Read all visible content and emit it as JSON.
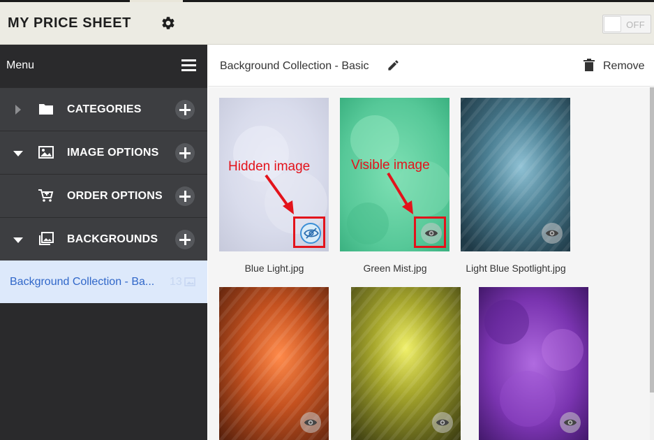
{
  "header": {
    "title": "MY PRICE SHEET",
    "toggle_label": "OFF"
  },
  "sidebar": {
    "menu_title": "Menu",
    "items": [
      {
        "label": "CATEGORIES",
        "icon": "folder-icon",
        "expanded": false
      },
      {
        "label": "IMAGE OPTIONS",
        "icon": "image-icon",
        "expanded": true
      },
      {
        "label": "ORDER OPTIONS",
        "icon": "cart-icon",
        "expanded": false
      },
      {
        "label": "BACKGROUNDS",
        "icon": "images-stack-icon",
        "expanded": true
      }
    ],
    "selected_collection": {
      "label": "Background Collection - Ba...",
      "count": "13"
    }
  },
  "main": {
    "title": "Background Collection - Basic",
    "remove_label": "Remove",
    "images": [
      {
        "name": "Blue Light.jpg",
        "visible": false
      },
      {
        "name": "Green Mist.jpg",
        "visible": true
      },
      {
        "name": "Light Blue Spotlight.jpg",
        "visible": true
      },
      {
        "name": "",
        "visible": true
      },
      {
        "name": "",
        "visible": true
      },
      {
        "name": "",
        "visible": true
      }
    ]
  },
  "annotations": {
    "hidden": "Hidden image",
    "visible": "Visible image"
  },
  "colors": {
    "accent_blue": "#3067c9",
    "annotation_red": "#e3131b",
    "sidebar_bg": "#2a2a2c",
    "nav_item_bg": "#3d3e41",
    "selected_bg": "#dde9fb"
  }
}
